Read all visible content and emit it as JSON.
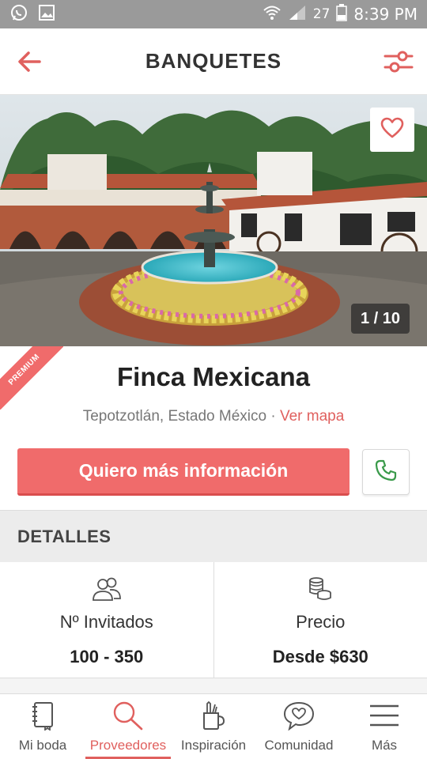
{
  "status_bar": {
    "battery_percent": "27",
    "time": "8:39 PM"
  },
  "header": {
    "title": "BANQUETES",
    "back_icon": "arrow-left-icon",
    "filter_icon": "sliders-icon"
  },
  "hero": {
    "photo_counter": "1 / 10",
    "favorite_icon": "heart-outline-icon"
  },
  "venue": {
    "badge": "PREMIUM",
    "name": "Finca Mexicana",
    "location": "Tepotzotlán, Estado México",
    "separator": " · ",
    "map_link": "Ver mapa"
  },
  "actions": {
    "cta_label": "Quiero más información",
    "phone_icon": "phone-icon"
  },
  "details": {
    "section_title": "DETALLES",
    "guests": {
      "label": "Nº Invitados",
      "value": "100 - 350",
      "icon": "people-icon"
    },
    "price": {
      "label": "Precio",
      "value": "Desde $630",
      "icon": "coins-icon"
    }
  },
  "nav": {
    "items": [
      {
        "label": "Mi boda",
        "icon": "notebook-icon"
      },
      {
        "label": "Proveedores",
        "icon": "search-icon",
        "active": true
      },
      {
        "label": "Inspiración",
        "icon": "pencil-cup-icon"
      },
      {
        "label": "Comunidad",
        "icon": "chat-heart-icon"
      },
      {
        "label": "Más",
        "icon": "menu-icon"
      }
    ]
  },
  "colors": {
    "accent": "#f06b6b",
    "link": "#e0605e",
    "phone_green": "#3a9a4a"
  }
}
